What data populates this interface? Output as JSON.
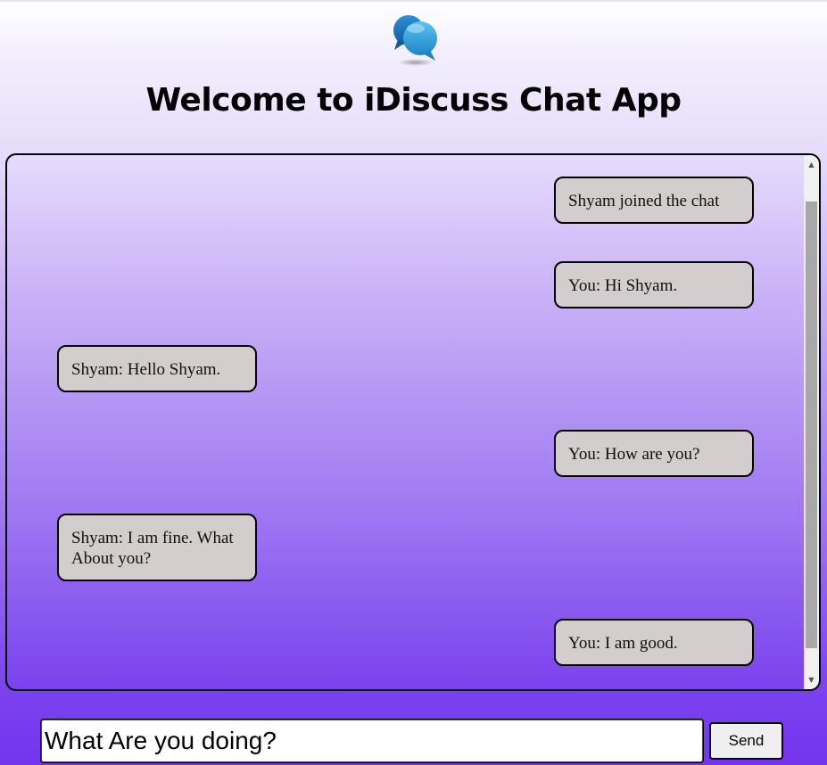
{
  "app": {
    "title": "Welcome to iDiscuss Chat App",
    "logo_icon": "chat-bubbles-icon",
    "accent_color": "#7434ee",
    "bubble_color": "#d3cdcd"
  },
  "messages": [
    {
      "text": "Shyam joined the chat",
      "side": "right"
    },
    {
      "text": "You: Hi Shyam.",
      "side": "right"
    },
    {
      "text": "Shyam: Hello Shyam.",
      "side": "left"
    },
    {
      "text": "You: How are you?",
      "side": "right"
    },
    {
      "text": "Shyam: I am fine. What About you?",
      "side": "left"
    },
    {
      "text": "You: I am good.",
      "side": "right"
    }
  ],
  "composer": {
    "value": "What Are you doing?",
    "send_label": "Send"
  },
  "scrollbar": {
    "up_icon": "triangle-up-icon",
    "down_icon": "triangle-down-icon"
  }
}
